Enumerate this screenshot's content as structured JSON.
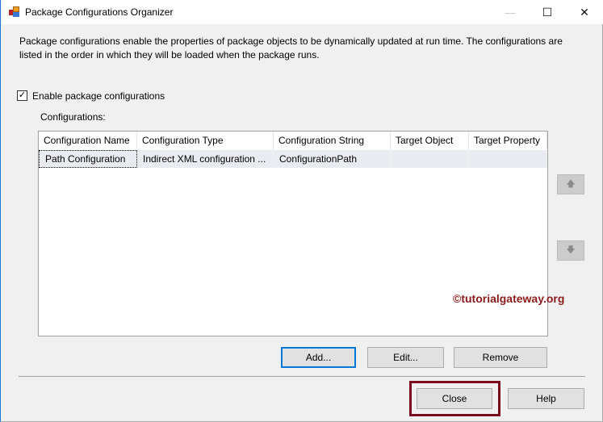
{
  "window": {
    "title": "Package Configurations Organizer",
    "minimize": "—",
    "maximize": "☐",
    "close": "✕"
  },
  "description": [
    "Package configurations enable the properties of package objects to be dynamically updated at run time. The configurations are",
    "listed in the order in which they will be loaded when the package runs."
  ],
  "enable_checkbox": {
    "label": "Enable package configurations",
    "checked": true,
    "mark": "✓"
  },
  "configurations_label": "Configurations:",
  "grid": {
    "columns": [
      "Configuration Name",
      "Configuration Type",
      "Configuration String",
      "Target Object",
      "Target Property"
    ],
    "rows": [
      [
        "Path Configuration",
        "Indirect XML configuration ...",
        "ConfigurationPath",
        "",
        ""
      ]
    ]
  },
  "move_up": "🡅",
  "move_down": "🡇",
  "watermark": "©tutorialgateway.org",
  "buttons": {
    "add": "Add...",
    "edit": "Edit...",
    "remove": "Remove",
    "close": "Close",
    "help": "Help"
  },
  "colors": {
    "highlight": "#7b0a1e",
    "focus": "#0078d7",
    "watermark": "#8b1a1a"
  }
}
